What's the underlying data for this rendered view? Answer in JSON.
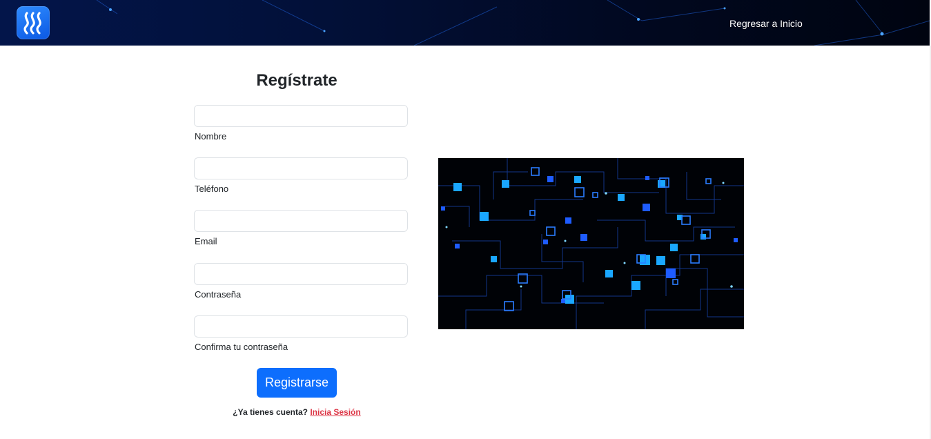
{
  "navbar": {
    "logo_icon": "wave-logo-icon",
    "home_link": "Regresar a Inicio"
  },
  "form": {
    "title": "Regístrate",
    "fields": [
      {
        "label": "Nombre",
        "value": "",
        "placeholder": ""
      },
      {
        "label": "Teléfono",
        "value": "",
        "placeholder": ""
      },
      {
        "label": "Email",
        "value": "",
        "placeholder": ""
      },
      {
        "label": "Contraseña",
        "value": "",
        "placeholder": ""
      },
      {
        "label": "Confirma tu contraseña",
        "value": "",
        "placeholder": ""
      }
    ],
    "submit_label": "Registrarse",
    "login_prompt": "¿Ya tienes cuenta?",
    "login_link": "Inicia Sesión"
  },
  "colors": {
    "navbar_bg": "#020a26",
    "primary": "#0d6efd",
    "link_red": "#dc3545",
    "text": "#212529",
    "input_border": "#dee2e6"
  },
  "illustration": {
    "icon": "circuit-network-image"
  }
}
